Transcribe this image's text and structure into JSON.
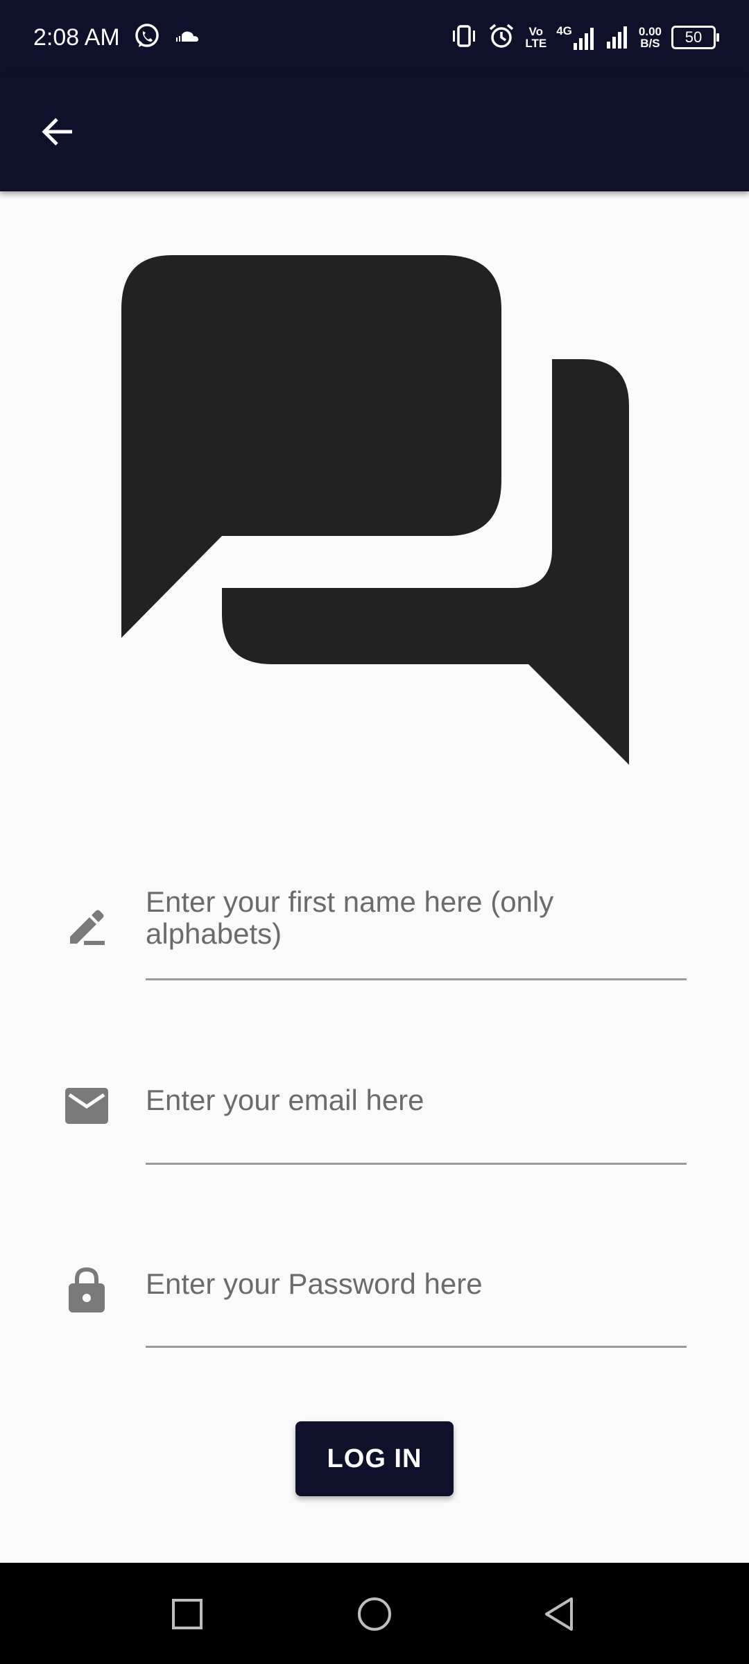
{
  "status_bar": {
    "time": "2:08 AM",
    "icons": [
      "whatsapp-icon",
      "soundcloud-icon",
      "vibrate-icon",
      "alarm-icon",
      "volte-icon",
      "4g-signal-icon",
      "signal-icon",
      "battery-icon"
    ],
    "volte_label_top": "Vo",
    "volte_label_bottom": "LTE",
    "network_label": "4G",
    "speed_value": "0.00",
    "speed_unit": "B/S",
    "battery_level": "50"
  },
  "app_bar": {
    "back_icon": "arrow-back-icon",
    "background_color": "#0f1029"
  },
  "logo": {
    "icon": "chat-bubbles-icon",
    "color": "#222222"
  },
  "form": {
    "first_name": {
      "icon": "pencil-icon",
      "placeholder": "Enter your first name here (only alphabets)",
      "value": ""
    },
    "email": {
      "icon": "email-icon",
      "placeholder": "Enter your email here",
      "value": ""
    },
    "password": {
      "icon": "lock-icon",
      "placeholder": "Enter your Password here",
      "value": ""
    },
    "login_label": "LOG IN",
    "accent_color": "#0f1029"
  },
  "nav_bar": {
    "buttons": [
      "recents-square-icon",
      "home-circle-icon",
      "back-triangle-icon"
    ]
  }
}
